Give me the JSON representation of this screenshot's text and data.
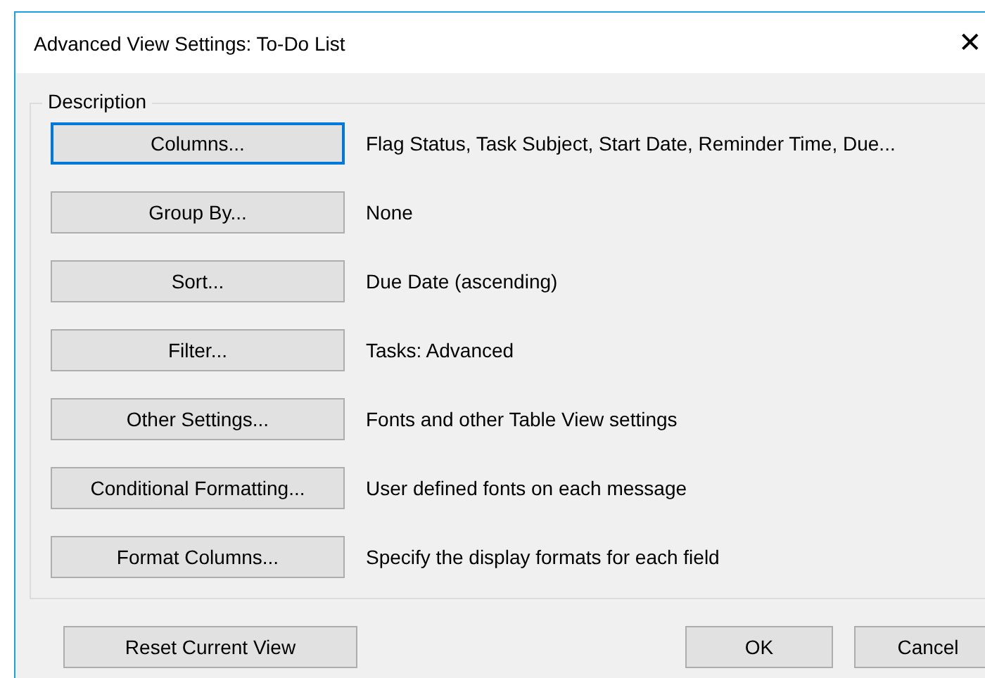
{
  "window": {
    "title": "Advanced View Settings: To-Do List",
    "close": "✕"
  },
  "group": {
    "label": "Description"
  },
  "rows": [
    {
      "button": "Columns...",
      "focused": true,
      "description": "Flag Status, Task Subject, Start Date, Reminder Time, Due..."
    },
    {
      "button": "Group By...",
      "focused": false,
      "description": "None"
    },
    {
      "button": "Sort...",
      "focused": false,
      "description": "Due Date (ascending)"
    },
    {
      "button": "Filter...",
      "focused": false,
      "description": "Tasks: Advanced"
    },
    {
      "button": "Other Settings...",
      "focused": false,
      "description": "Fonts and other Table View settings"
    },
    {
      "button": "Conditional Formatting...",
      "focused": false,
      "description": "User defined fonts on each message"
    },
    {
      "button": "Format Columns...",
      "focused": false,
      "description": "Specify the display formats for each field"
    }
  ],
  "footer": {
    "reset": "Reset Current View",
    "buttons": [
      "OK",
      "Cancel"
    ]
  }
}
